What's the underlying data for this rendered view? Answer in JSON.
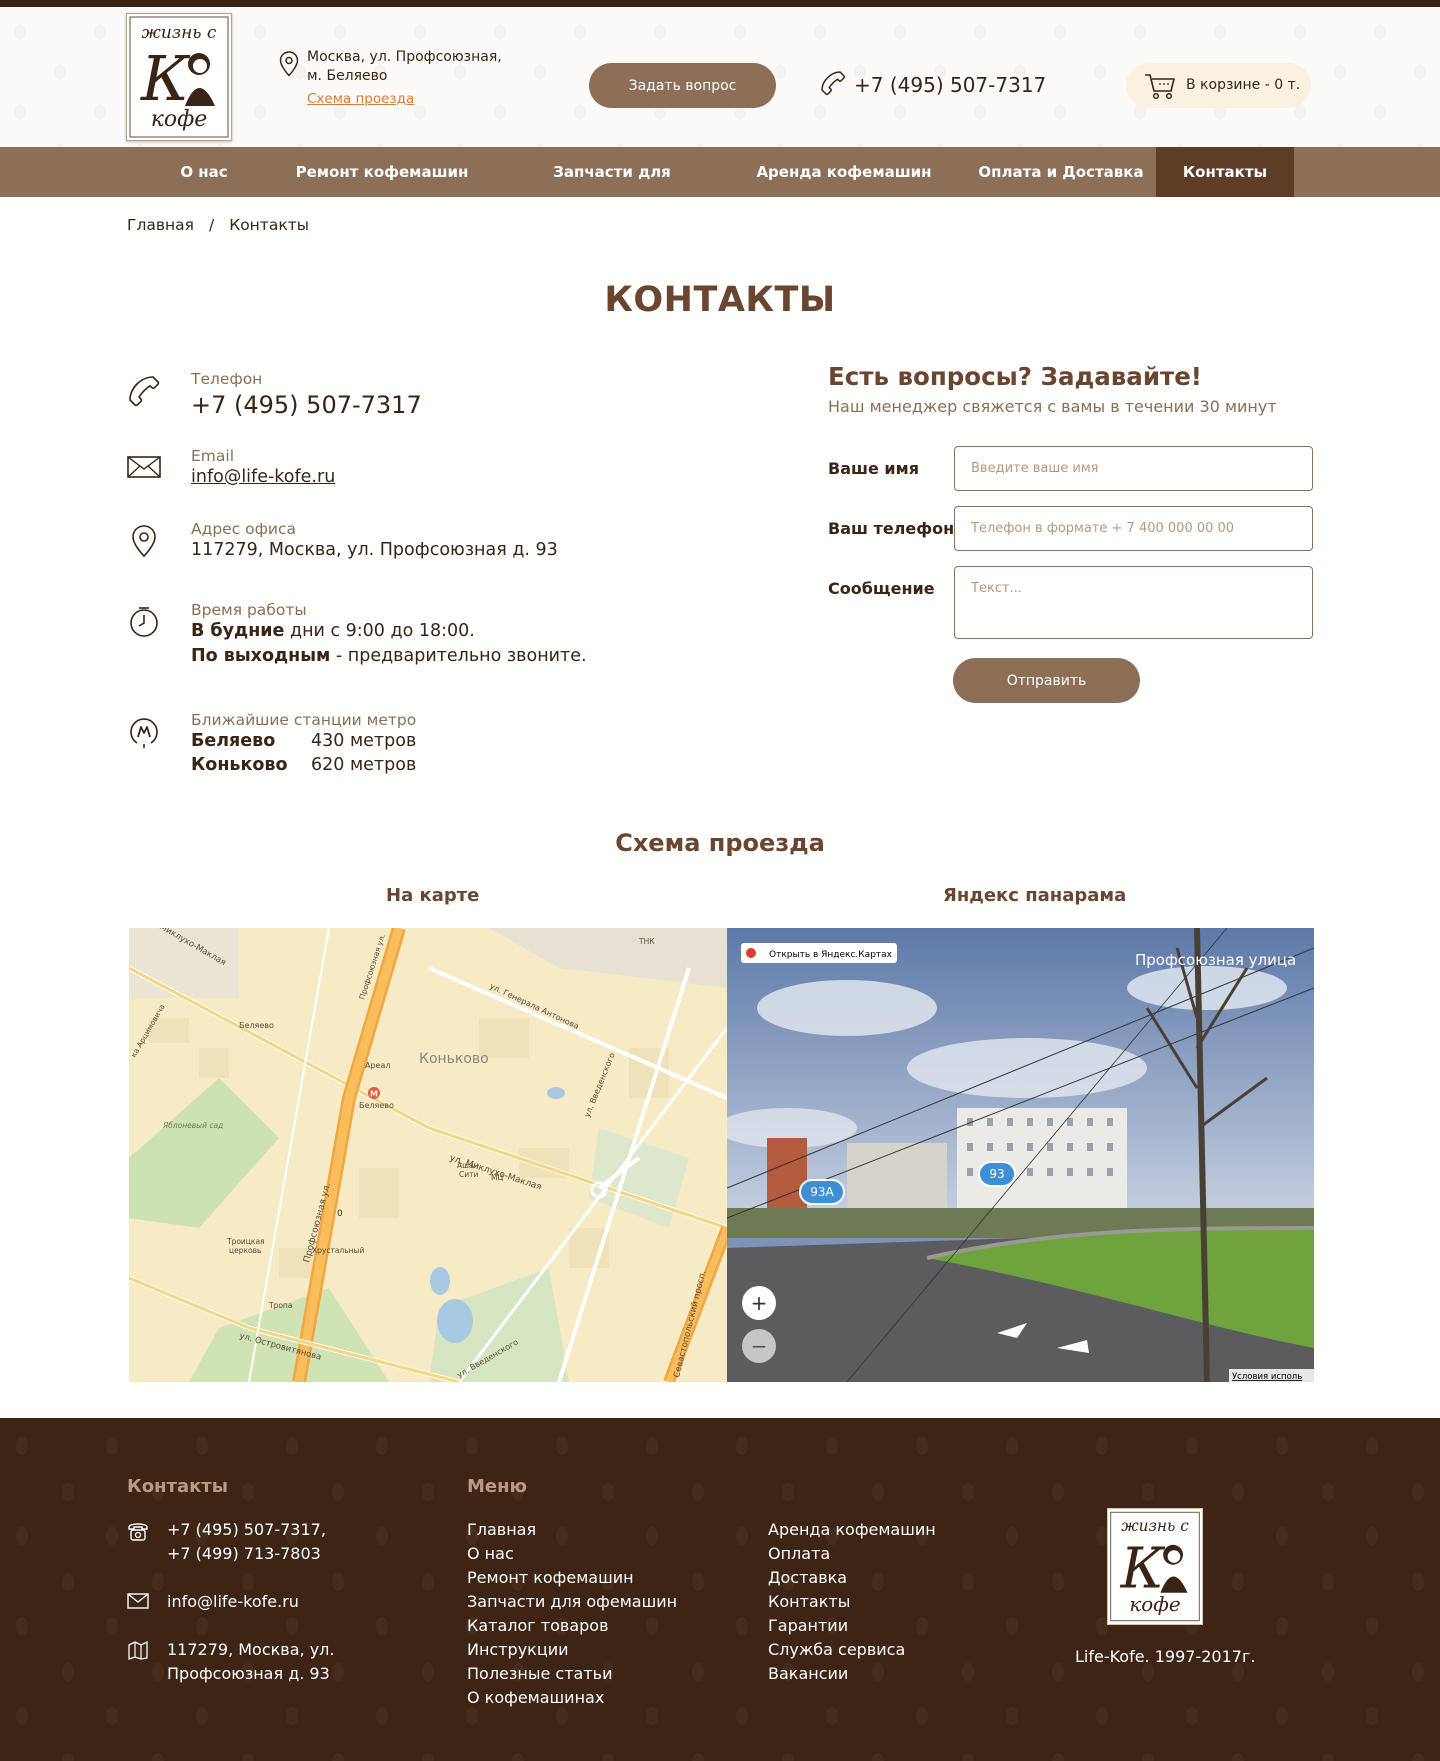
{
  "logo": {
    "line1": "жизнь с",
    "letter": "К",
    "line2": "кофе"
  },
  "header": {
    "address_line1": "Москва, ул. Профсоюзная,",
    "address_line2": "м. Беляево",
    "route_link": "Схема проезда",
    "ask_button": "Задать вопрос",
    "phone": "+7 (495) 507-7317",
    "cart": "В корзине - 0 т."
  },
  "nav": {
    "items": [
      "О нас",
      "Ремонт кофемашин",
      "Запчасти для кофемашин",
      "Аренда кофемашин",
      "Оплата и Доставка",
      "Контакты"
    ],
    "active": "Контакты"
  },
  "breadcrumb": {
    "home": "Главная",
    "separator": "/",
    "current": "Контакты"
  },
  "page_title": "КОНТАКТЫ",
  "contacts": {
    "phone_label": "Телефон",
    "phone_value": "+7 (495) 507-7317",
    "email_label": "Email",
    "email_value": "info@life-kofe.ru",
    "office_label": "Адрес офиса",
    "office_value": "117279, Москва, ул. Профсоюзная д. 93",
    "hours_label": "Время работы",
    "weekdays_bold": "В будние",
    "weekdays_text": " дни с 9:00 до 18:00.",
    "weekend_bold": "По выходным",
    "weekend_text": " - предварительно звоните.",
    "metro_label": "Ближайшие станции метро",
    "metro": [
      {
        "station": "Беляево",
        "distance": "430 метров"
      },
      {
        "station": "Коньково",
        "distance": "620 метров"
      }
    ]
  },
  "form": {
    "title": "Есть вопросы? Задавайте!",
    "subtitle": "Наш менеджер свяжется с вамы в течении 30 минут",
    "name_label": "Ваше имя",
    "name_placeholder": "Введите ваше имя",
    "phone_label": "Ваш телефон",
    "phone_placeholder": "Телефон в формате + 7 400 000 00 00",
    "message_label": "Сообщение",
    "message_placeholder": "Текст...",
    "submit": "Отправить"
  },
  "scheme": {
    "title": "Схема проезда",
    "map_tab": "На карте",
    "pano_tab": "Яндекс панарама",
    "map_labels": {
      "district": "Коньково",
      "metro_station": "Беляево",
      "place_belyaevo": "Беляево",
      "areal": "Ареал",
      "orchard": "Яблоневый сад",
      "church_1": "Троицкая",
      "church_2": "церковь",
      "khrustalny": "Хрустальный",
      "ashan_1": "Ашан",
      "ashan_2": "Сити",
      "mts": "МЦ",
      "tropa": "Тропа",
      "tnk": "ТНК",
      "house_number": "0",
      "street_maklaya": "ул. Миклухо-Маклая",
      "street_maklaya_nw": "Миклухо-Маклая",
      "street_profsoyuznaya": "Профсоюзная ул.",
      "street_profsoyuznaya_top": "Профсоюзная ул.",
      "street_antonova": "ул. Генерала Антонова",
      "street_vvedenskogo": "ул. Введенского",
      "street_vvedenskogo_2": "ул. Введенского",
      "street_sevastopolsky": "Севастопольский просп.",
      "street_ostrovityanova": "ул. Островитянова",
      "street_arcimovicha": "ка Арцимовича"
    },
    "pano": {
      "open_link": "Открыть в Яндекс.Картах",
      "street": "Профсоюзная улица",
      "badge_93a": "93А",
      "badge_93": "93",
      "zoom_in": "+",
      "zoom_out": "−",
      "terms": "Условия исполь"
    }
  },
  "footer": {
    "contacts_head": "Контакты",
    "phone1": "+7 (495) 507-7317,",
    "phone2": "+7 (499) 713-7803",
    "email": "info@life-kofe.ru",
    "addr1": "117279, Москва, ул.",
    "addr2": "Профсоюзная д. 93",
    "menu_head": "Меню",
    "menu_col1": [
      "Главная",
      "О нас",
      "Ремонт кофемашин",
      "Запчасти для офемашин",
      "Каталог товаров",
      "Инструкции",
      "Полезные статьи",
      "О кофемашинах"
    ],
    "menu_col2": [
      "Аренда кофемашин",
      "Оплата",
      "Доставка",
      "Контакты",
      "Гарантии",
      "Служба сервиса",
      "Вакансии"
    ],
    "copyright": "Life-Kofe. 1997-2017г."
  },
  "colors": {
    "brand_brown": "#8d6f58",
    "dark_brown": "#3e2415",
    "accent_orange": "#d87b3a",
    "title_brown": "#6a4630"
  }
}
